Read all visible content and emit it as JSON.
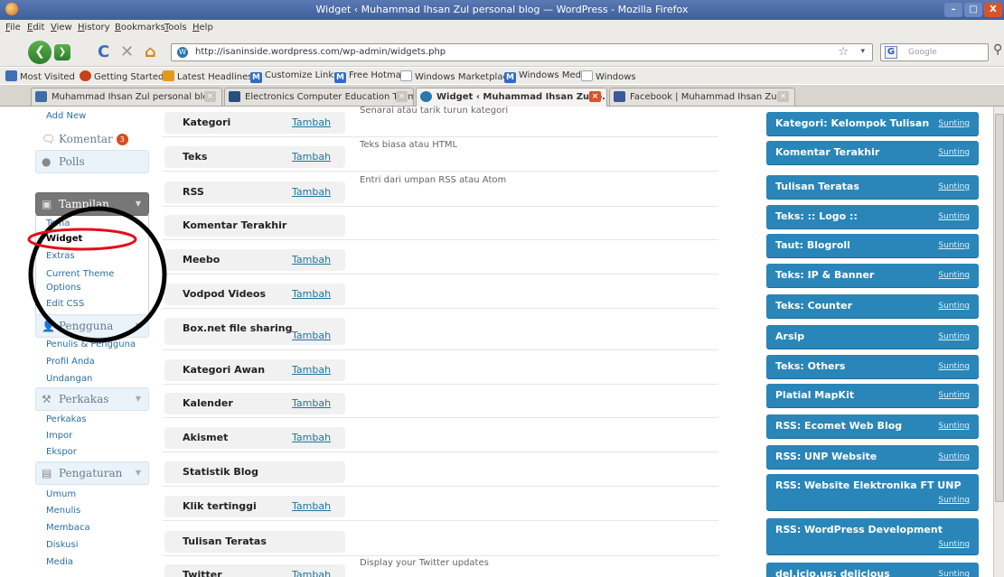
{
  "window": {
    "title": "Widget ‹ Muhammad Ihsan Zul personal blog — WordPress - Mozilla Firefox",
    "min_glyph": "–",
    "max_glyph": "□",
    "close_glyph": "X"
  },
  "menu": [
    "File",
    "Edit",
    "View",
    "History",
    "Bookmarks",
    "Tools",
    "Help"
  ],
  "nav": {
    "url": "http://isaninside.wordpress.com/wp-admin/widgets.php",
    "search_placeholder": "Google",
    "back_glyph": "❮",
    "fwd_glyph": "❯",
    "reload_glyph": "C",
    "stop_glyph": "✕",
    "home_glyph": "⌂",
    "star_glyph": "☆",
    "drop_glyph": "▾",
    "search_engine_glyph": "G",
    "search_glyph": "⚲",
    "site_glyph": "W"
  },
  "bookmarks": [
    {
      "label": "Most Visited",
      "color": "#3f6fb4"
    },
    {
      "label": "Getting Started",
      "color": "#c8401a"
    },
    {
      "label": "Latest Headlines",
      "color": "#e39a1c"
    },
    {
      "label": "Customize Links",
      "color": "#2f6cc8",
      "glyph": "M"
    },
    {
      "label": "Free Hotmail",
      "color": "#2f6cc8",
      "glyph": "M"
    },
    {
      "label": "Windows Marketplace",
      "color": "#9aa4b0"
    },
    {
      "label": "Windows Media",
      "color": "#2f6cc8",
      "glyph": "M"
    },
    {
      "label": "Windows",
      "color": "#9aa4b0"
    }
  ],
  "tabs": [
    {
      "label": "Muhammad Ihsan Zul personal blog",
      "active": false
    },
    {
      "label": "Electronics Computer Education Team",
      "active": false
    },
    {
      "label": "Widget ‹ Muhammad Ihsan Zul p...",
      "active": true
    },
    {
      "label": "Facebook | Muhammad Ihsan Zul",
      "active": false
    }
  ],
  "sidebar": {
    "top_links": [
      "Add New"
    ],
    "comments": {
      "label": "Komentar",
      "badge": "3"
    },
    "polls": "Polls",
    "appearance": {
      "label": "Tampilan",
      "items": [
        "Tema",
        "Widget",
        "Extras",
        "Current Theme Options",
        "Edit CSS"
      ],
      "current": "Widget"
    },
    "users": {
      "label": "Pengguna",
      "items": [
        "Penulis & Pengguna",
        "Profil Anda",
        "Undangan"
      ]
    },
    "tools": {
      "label": "Perkakas",
      "items": [
        "Perkakas",
        "Impor",
        "Ekspor"
      ]
    },
    "settings": {
      "label": "Pengaturan",
      "items": [
        "Umum",
        "Menulis",
        "Membaca",
        "Diskusi",
        "Media"
      ]
    }
  },
  "widgets": [
    {
      "name": "Kategori",
      "add": "Tambah",
      "desc": "Senarai atau tarik turun kategori"
    },
    {
      "name": "Teks",
      "add": "Tambah",
      "desc": "Teks biasa atau HTML"
    },
    {
      "name": "RSS",
      "add": "Tambah",
      "desc": "Entri dari umpan RSS atau Atom"
    },
    {
      "name": "Komentar Terakhir",
      "add": "",
      "desc": ""
    },
    {
      "name": "Meebo",
      "add": "Tambah",
      "desc": ""
    },
    {
      "name": "Vodpod Videos",
      "add": "Tambah",
      "desc": ""
    },
    {
      "name": "Box.net file sharing",
      "add": "Tambah",
      "desc": ""
    },
    {
      "name": "Kategori Awan",
      "add": "Tambah",
      "desc": ""
    },
    {
      "name": "Kalender",
      "add": "Tambah",
      "desc": ""
    },
    {
      "name": "Akismet",
      "add": "Tambah",
      "desc": ""
    },
    {
      "name": "Statistik Blog",
      "add": "",
      "desc": ""
    },
    {
      "name": "Klik tertinggi",
      "add": "Tambah",
      "desc": ""
    },
    {
      "name": "Tulisan Teratas",
      "add": "",
      "desc": ""
    },
    {
      "name": "Twitter",
      "add": "Tambah",
      "desc": "Display your Twitter updates"
    }
  ],
  "sidebar_widgets": [
    {
      "title": "Kategori: Kelompok Tulisan",
      "edit": "Sunting"
    },
    {
      "title": "Komentar Terakhir",
      "edit": "Sunting"
    },
    {
      "title": "Tulisan Teratas",
      "edit": "Sunting"
    },
    {
      "title": "Teks: :: Logo ::",
      "edit": "Sunting"
    },
    {
      "title": "Taut: Blogroll",
      "edit": "Sunting"
    },
    {
      "title": "Teks: IP & Banner",
      "edit": "Sunting"
    },
    {
      "title": "Teks: Counter",
      "edit": "Sunting"
    },
    {
      "title": "Arsip",
      "edit": "Sunting"
    },
    {
      "title": "Teks: Others",
      "edit": "Sunting"
    },
    {
      "title": "Platial MapKit",
      "edit": "Sunting"
    },
    {
      "title": "RSS: Ecomet Web Blog",
      "edit": "Sunting"
    },
    {
      "title": "RSS: UNP Website",
      "edit": "Sunting"
    },
    {
      "title": "RSS: Website Elektronika FT UNP",
      "edit": "Sunting"
    },
    {
      "title": "RSS: WordPress Development",
      "edit": "Sunting"
    },
    {
      "title": "del.icio.us: delicious",
      "edit": "Sunting"
    }
  ],
  "colors": {
    "accent": "#2a86b8",
    "link": "#21759b",
    "annotation_black": "#000000",
    "annotation_red": "#e0101a"
  }
}
